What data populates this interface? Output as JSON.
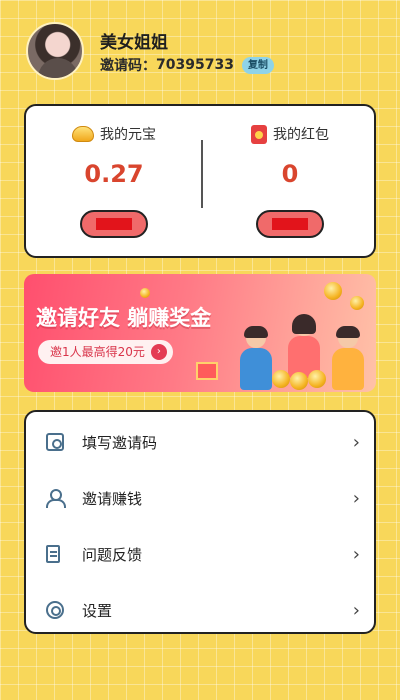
{
  "profile": {
    "nickname": "美女姐姐",
    "invite_label": "邀请码：",
    "invite_code": "70395733",
    "copy_label": "复制"
  },
  "wallet": {
    "left": {
      "title": "我的元宝",
      "amount": "0.27",
      "icon": "gold-ingot-icon"
    },
    "right": {
      "title": "我的红包",
      "amount": "0",
      "icon": "red-packet-icon"
    },
    "action_color": "#e2141b"
  },
  "banner": {
    "title": "邀请好友 躺赚奖金",
    "pill_text": "邀1人最高得20元",
    "pill_icon": "arrow-circle-icon"
  },
  "menu": {
    "items": [
      {
        "label": "填写邀请码",
        "icon": "id-card-icon"
      },
      {
        "label": "邀请赚钱",
        "icon": "user-invite-icon"
      },
      {
        "label": "问题反馈",
        "icon": "feedback-doc-icon"
      },
      {
        "label": "设置",
        "icon": "settings-gear-icon"
      }
    ],
    "chevron": "›"
  },
  "colors": {
    "background": "#f8d75a",
    "amount": "#d9452e",
    "banner_start": "#ff4f6e",
    "banner_end": "#ffc2a8"
  }
}
